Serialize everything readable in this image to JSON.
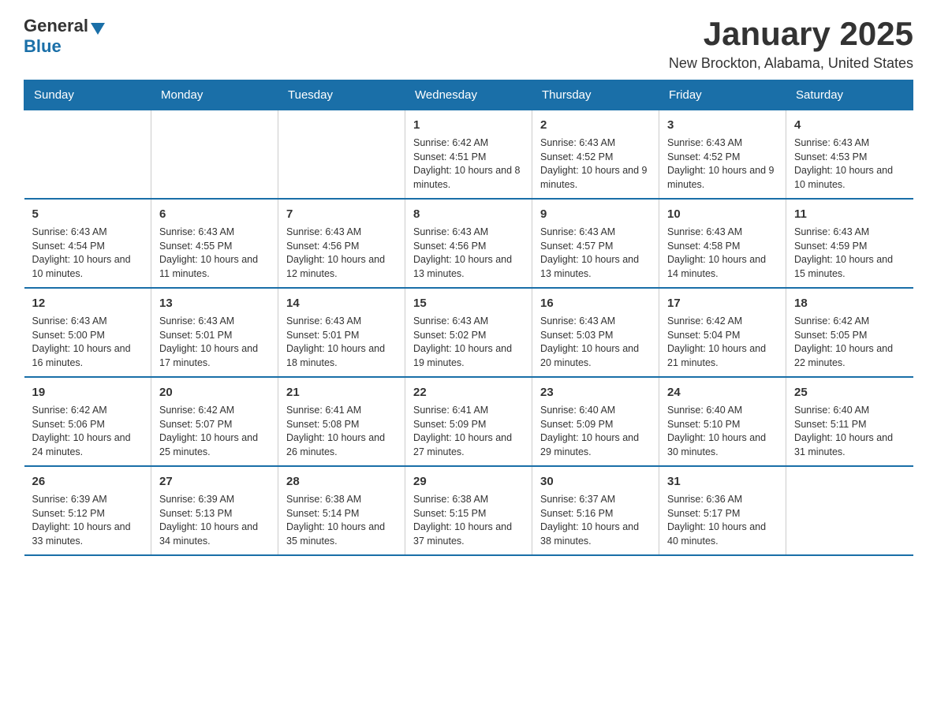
{
  "header": {
    "logo_general": "General",
    "logo_blue": "Blue",
    "title": "January 2025",
    "subtitle": "New Brockton, Alabama, United States"
  },
  "calendar": {
    "days_of_week": [
      "Sunday",
      "Monday",
      "Tuesday",
      "Wednesday",
      "Thursday",
      "Friday",
      "Saturday"
    ],
    "weeks": [
      [
        {
          "day": "",
          "info": ""
        },
        {
          "day": "",
          "info": ""
        },
        {
          "day": "",
          "info": ""
        },
        {
          "day": "1",
          "info": "Sunrise: 6:42 AM\nSunset: 4:51 PM\nDaylight: 10 hours and 8 minutes."
        },
        {
          "day": "2",
          "info": "Sunrise: 6:43 AM\nSunset: 4:52 PM\nDaylight: 10 hours and 9 minutes."
        },
        {
          "day": "3",
          "info": "Sunrise: 6:43 AM\nSunset: 4:52 PM\nDaylight: 10 hours and 9 minutes."
        },
        {
          "day": "4",
          "info": "Sunrise: 6:43 AM\nSunset: 4:53 PM\nDaylight: 10 hours and 10 minutes."
        }
      ],
      [
        {
          "day": "5",
          "info": "Sunrise: 6:43 AM\nSunset: 4:54 PM\nDaylight: 10 hours and 10 minutes."
        },
        {
          "day": "6",
          "info": "Sunrise: 6:43 AM\nSunset: 4:55 PM\nDaylight: 10 hours and 11 minutes."
        },
        {
          "day": "7",
          "info": "Sunrise: 6:43 AM\nSunset: 4:56 PM\nDaylight: 10 hours and 12 minutes."
        },
        {
          "day": "8",
          "info": "Sunrise: 6:43 AM\nSunset: 4:56 PM\nDaylight: 10 hours and 13 minutes."
        },
        {
          "day": "9",
          "info": "Sunrise: 6:43 AM\nSunset: 4:57 PM\nDaylight: 10 hours and 13 minutes."
        },
        {
          "day": "10",
          "info": "Sunrise: 6:43 AM\nSunset: 4:58 PM\nDaylight: 10 hours and 14 minutes."
        },
        {
          "day": "11",
          "info": "Sunrise: 6:43 AM\nSunset: 4:59 PM\nDaylight: 10 hours and 15 minutes."
        }
      ],
      [
        {
          "day": "12",
          "info": "Sunrise: 6:43 AM\nSunset: 5:00 PM\nDaylight: 10 hours and 16 minutes."
        },
        {
          "day": "13",
          "info": "Sunrise: 6:43 AM\nSunset: 5:01 PM\nDaylight: 10 hours and 17 minutes."
        },
        {
          "day": "14",
          "info": "Sunrise: 6:43 AM\nSunset: 5:01 PM\nDaylight: 10 hours and 18 minutes."
        },
        {
          "day": "15",
          "info": "Sunrise: 6:43 AM\nSunset: 5:02 PM\nDaylight: 10 hours and 19 minutes."
        },
        {
          "day": "16",
          "info": "Sunrise: 6:43 AM\nSunset: 5:03 PM\nDaylight: 10 hours and 20 minutes."
        },
        {
          "day": "17",
          "info": "Sunrise: 6:42 AM\nSunset: 5:04 PM\nDaylight: 10 hours and 21 minutes."
        },
        {
          "day": "18",
          "info": "Sunrise: 6:42 AM\nSunset: 5:05 PM\nDaylight: 10 hours and 22 minutes."
        }
      ],
      [
        {
          "day": "19",
          "info": "Sunrise: 6:42 AM\nSunset: 5:06 PM\nDaylight: 10 hours and 24 minutes."
        },
        {
          "day": "20",
          "info": "Sunrise: 6:42 AM\nSunset: 5:07 PM\nDaylight: 10 hours and 25 minutes."
        },
        {
          "day": "21",
          "info": "Sunrise: 6:41 AM\nSunset: 5:08 PM\nDaylight: 10 hours and 26 minutes."
        },
        {
          "day": "22",
          "info": "Sunrise: 6:41 AM\nSunset: 5:09 PM\nDaylight: 10 hours and 27 minutes."
        },
        {
          "day": "23",
          "info": "Sunrise: 6:40 AM\nSunset: 5:09 PM\nDaylight: 10 hours and 29 minutes."
        },
        {
          "day": "24",
          "info": "Sunrise: 6:40 AM\nSunset: 5:10 PM\nDaylight: 10 hours and 30 minutes."
        },
        {
          "day": "25",
          "info": "Sunrise: 6:40 AM\nSunset: 5:11 PM\nDaylight: 10 hours and 31 minutes."
        }
      ],
      [
        {
          "day": "26",
          "info": "Sunrise: 6:39 AM\nSunset: 5:12 PM\nDaylight: 10 hours and 33 minutes."
        },
        {
          "day": "27",
          "info": "Sunrise: 6:39 AM\nSunset: 5:13 PM\nDaylight: 10 hours and 34 minutes."
        },
        {
          "day": "28",
          "info": "Sunrise: 6:38 AM\nSunset: 5:14 PM\nDaylight: 10 hours and 35 minutes."
        },
        {
          "day": "29",
          "info": "Sunrise: 6:38 AM\nSunset: 5:15 PM\nDaylight: 10 hours and 37 minutes."
        },
        {
          "day": "30",
          "info": "Sunrise: 6:37 AM\nSunset: 5:16 PM\nDaylight: 10 hours and 38 minutes."
        },
        {
          "day": "31",
          "info": "Sunrise: 6:36 AM\nSunset: 5:17 PM\nDaylight: 10 hours and 40 minutes."
        },
        {
          "day": "",
          "info": ""
        }
      ]
    ]
  }
}
